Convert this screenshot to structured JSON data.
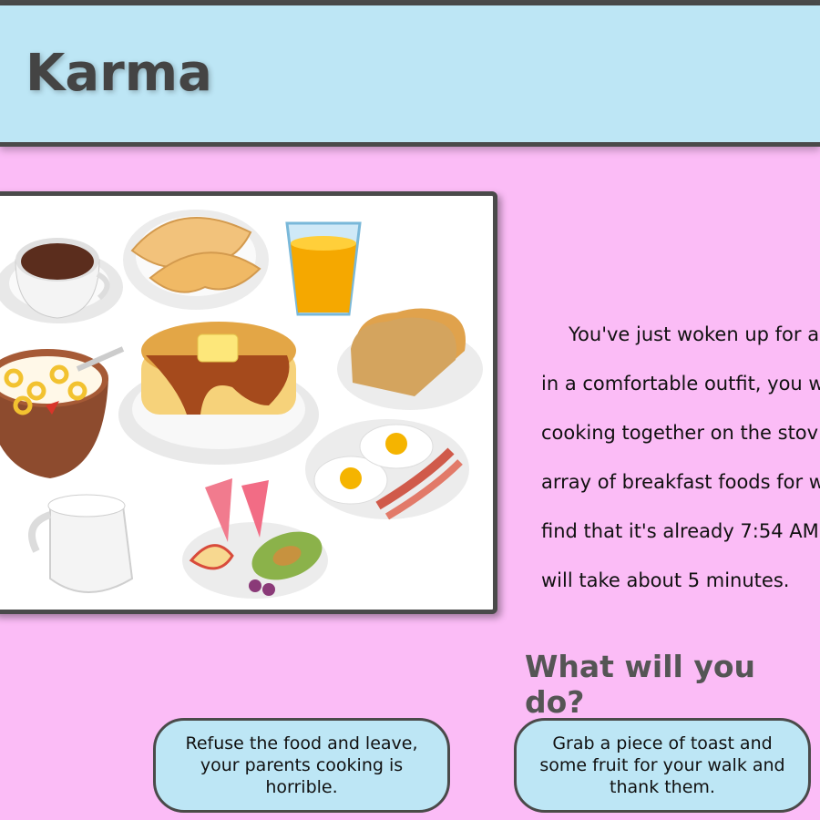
{
  "header": {
    "title": "Karma"
  },
  "image": {
    "alt": "breakfast foods illustration"
  },
  "story": {
    "lines": [
      "You've just woken up for a",
      "in a comfortable outfit, you w",
      "cooking together on the stov",
      "array of breakfast foods for w",
      "find that it's already 7:54 AM",
      "will take about 5 minutes."
    ]
  },
  "question": "What will you do?",
  "choices": [
    "Refuse the food and leave, your parents cooking is horrible.",
    "Grab a piece of toast and some fruit for your walk and thank them."
  ],
  "colors": {
    "background": "#fbbcf6",
    "header": "#bde6f5",
    "border": "#4a4a4a"
  }
}
